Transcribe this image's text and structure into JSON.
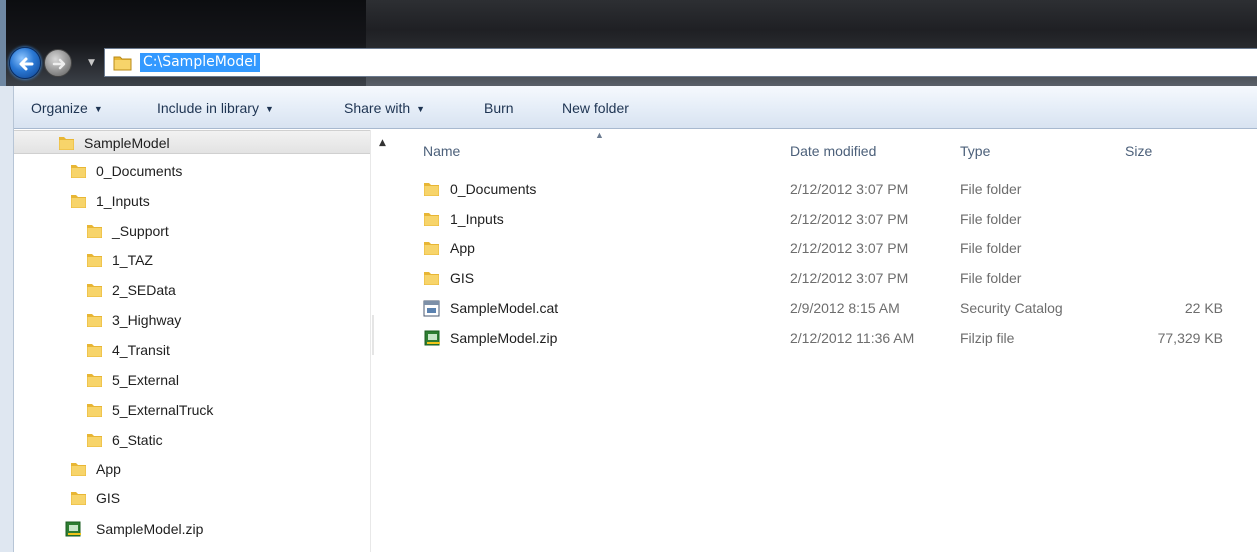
{
  "address_bar": {
    "path": "C:\\SampleModel"
  },
  "toolbar": {
    "organize": "Organize",
    "include_in_library": "Include in library",
    "share_with": "Share with",
    "burn": "Burn",
    "new_folder": "New folder"
  },
  "nav_tree": {
    "items": [
      {
        "label": "SampleModel",
        "icon": "folder-icon",
        "level": 0
      },
      {
        "label": "0_Documents",
        "icon": "folder-icon",
        "level": 1
      },
      {
        "label": "1_Inputs",
        "icon": "folder-icon",
        "level": 1
      },
      {
        "label": "_Support",
        "icon": "folder-icon",
        "level": 2
      },
      {
        "label": "1_TAZ",
        "icon": "folder-icon",
        "level": 2
      },
      {
        "label": "2_SEData",
        "icon": "folder-icon",
        "level": 2
      },
      {
        "label": "3_Highway",
        "icon": "folder-icon",
        "level": 2
      },
      {
        "label": "4_Transit",
        "icon": "folder-icon",
        "level": 2
      },
      {
        "label": "5_External",
        "icon": "folder-icon",
        "level": 2
      },
      {
        "label": "5_ExternalTruck",
        "icon": "folder-icon",
        "level": 2
      },
      {
        "label": "6_Static",
        "icon": "folder-icon",
        "level": 2
      },
      {
        "label": "App",
        "icon": "folder-icon",
        "level": 1
      },
      {
        "label": "GIS",
        "icon": "folder-icon",
        "level": 1
      },
      {
        "label": "SampleModel.zip",
        "icon": "zip-file-icon",
        "level": 0
      }
    ]
  },
  "file_list": {
    "columns": {
      "name": "Name",
      "date_modified": "Date modified",
      "type": "Type",
      "size": "Size"
    },
    "rows": [
      {
        "name": "0_Documents",
        "date": "2/12/2012 3:07 PM",
        "type": "File folder",
        "size": "",
        "icon": "folder-icon"
      },
      {
        "name": "1_Inputs",
        "date": "2/12/2012 3:07 PM",
        "type": "File folder",
        "size": "",
        "icon": "folder-icon"
      },
      {
        "name": "App",
        "date": "2/12/2012 3:07 PM",
        "type": "File folder",
        "size": "",
        "icon": "folder-icon"
      },
      {
        "name": "GIS",
        "date": "2/12/2012 3:07 PM",
        "type": "File folder",
        "size": "",
        "icon": "folder-icon"
      },
      {
        "name": "SampleModel.cat",
        "date": "2/9/2012 8:15 AM",
        "type": "Security Catalog",
        "size": "22 KB",
        "icon": "security-catalog-icon"
      },
      {
        "name": "SampleModel.zip",
        "date": "2/12/2012 11:36 AM",
        "type": "Filzip file",
        "size": "77,329 KB",
        "icon": "zip-file-icon"
      }
    ]
  },
  "colors": {
    "selection": "#3399ff",
    "folder": "#e8b634",
    "toolbar_text": "#1e3452"
  }
}
